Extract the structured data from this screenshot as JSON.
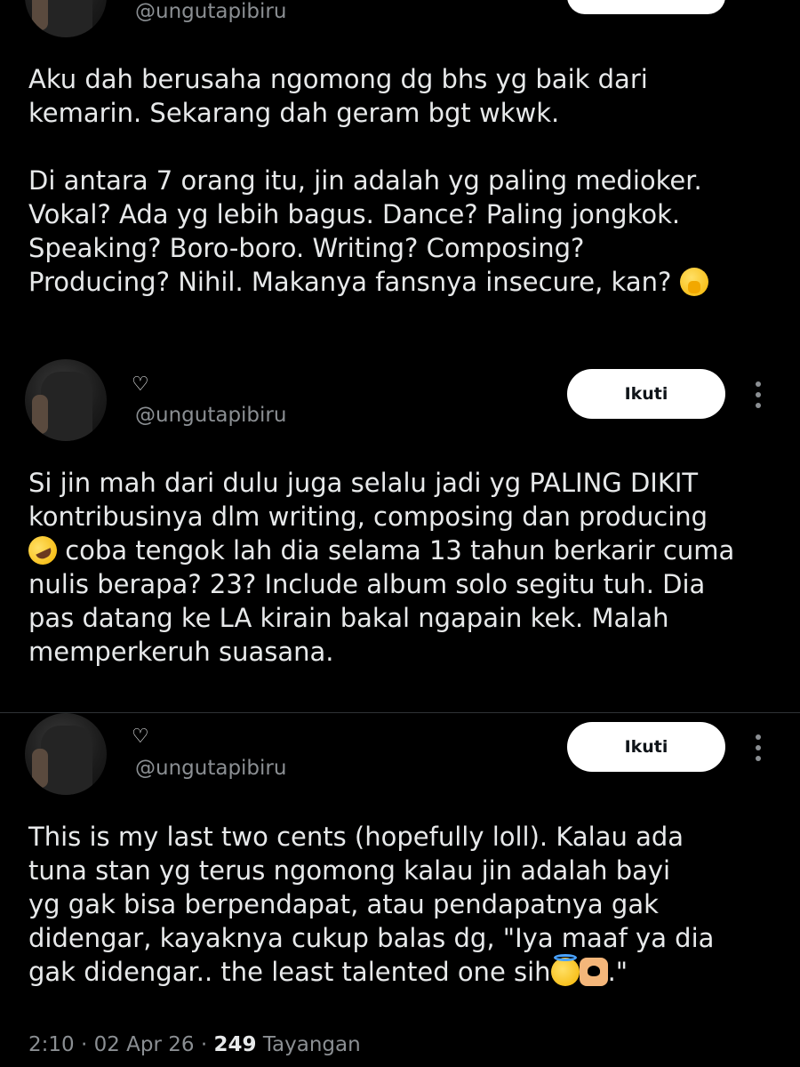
{
  "tweets": [
    {
      "handle": "@ungutapibiru",
      "text": "Aku dah berusaha ngomong dg bhs yg baik dari\nkemarin. Sekarang dah geram bgt wkwk.\n\nDi antara 7 orang itu, jin adalah yg paling medioker.\nVokal? Ada yg lebih bagus. Dance? Paling jongkok.\nSpeaking? Boro-boro. Writing? Composing?\nProducing? Nihil. Makanya fansnya insecure, kan? ",
      "emoji": "face-with-hand-over-mouth"
    },
    {
      "heart": "♡",
      "handle": "@ungutapibiru",
      "follow_label": "Ikuti",
      "text_before": "Si jin mah dari dulu juga selalu jadi yg PALING DIKIT\nkontribusinya dlm writing, composing dan producing\n",
      "emoji": "rolling-on-floor-laughing",
      "text_after": " coba tengok lah dia selama 13 tahun berkarir cuma\nnulis berapa? 23? Include album solo segitu tuh. Dia\npas datang ke LA kirain bakal ngapain kek. Malah\nmemperkeruh suasana."
    },
    {
      "heart": "♡",
      "handle": "@ungutapibiru",
      "follow_label": "Ikuti",
      "text_before": "This is my last two cents (hopefully loll). Kalau ada\ntuna stan yg terus ngomong kalau jin adalah bayi\nyg gak bisa berpendapat, atau pendapatnya gak\ndidengar, kayaknya cukup balas dg, \"Iya maaf ya dia\ngak didengar.. the least talented one sih",
      "emojis": [
        "smiling-face-with-halo",
        "heart-hands"
      ],
      "text_after": ".\""
    }
  ],
  "meta": {
    "time": "2:10",
    "separator": "·",
    "date": "02 Apr 26",
    "views_count": "249",
    "views_label": "Tayangan"
  }
}
